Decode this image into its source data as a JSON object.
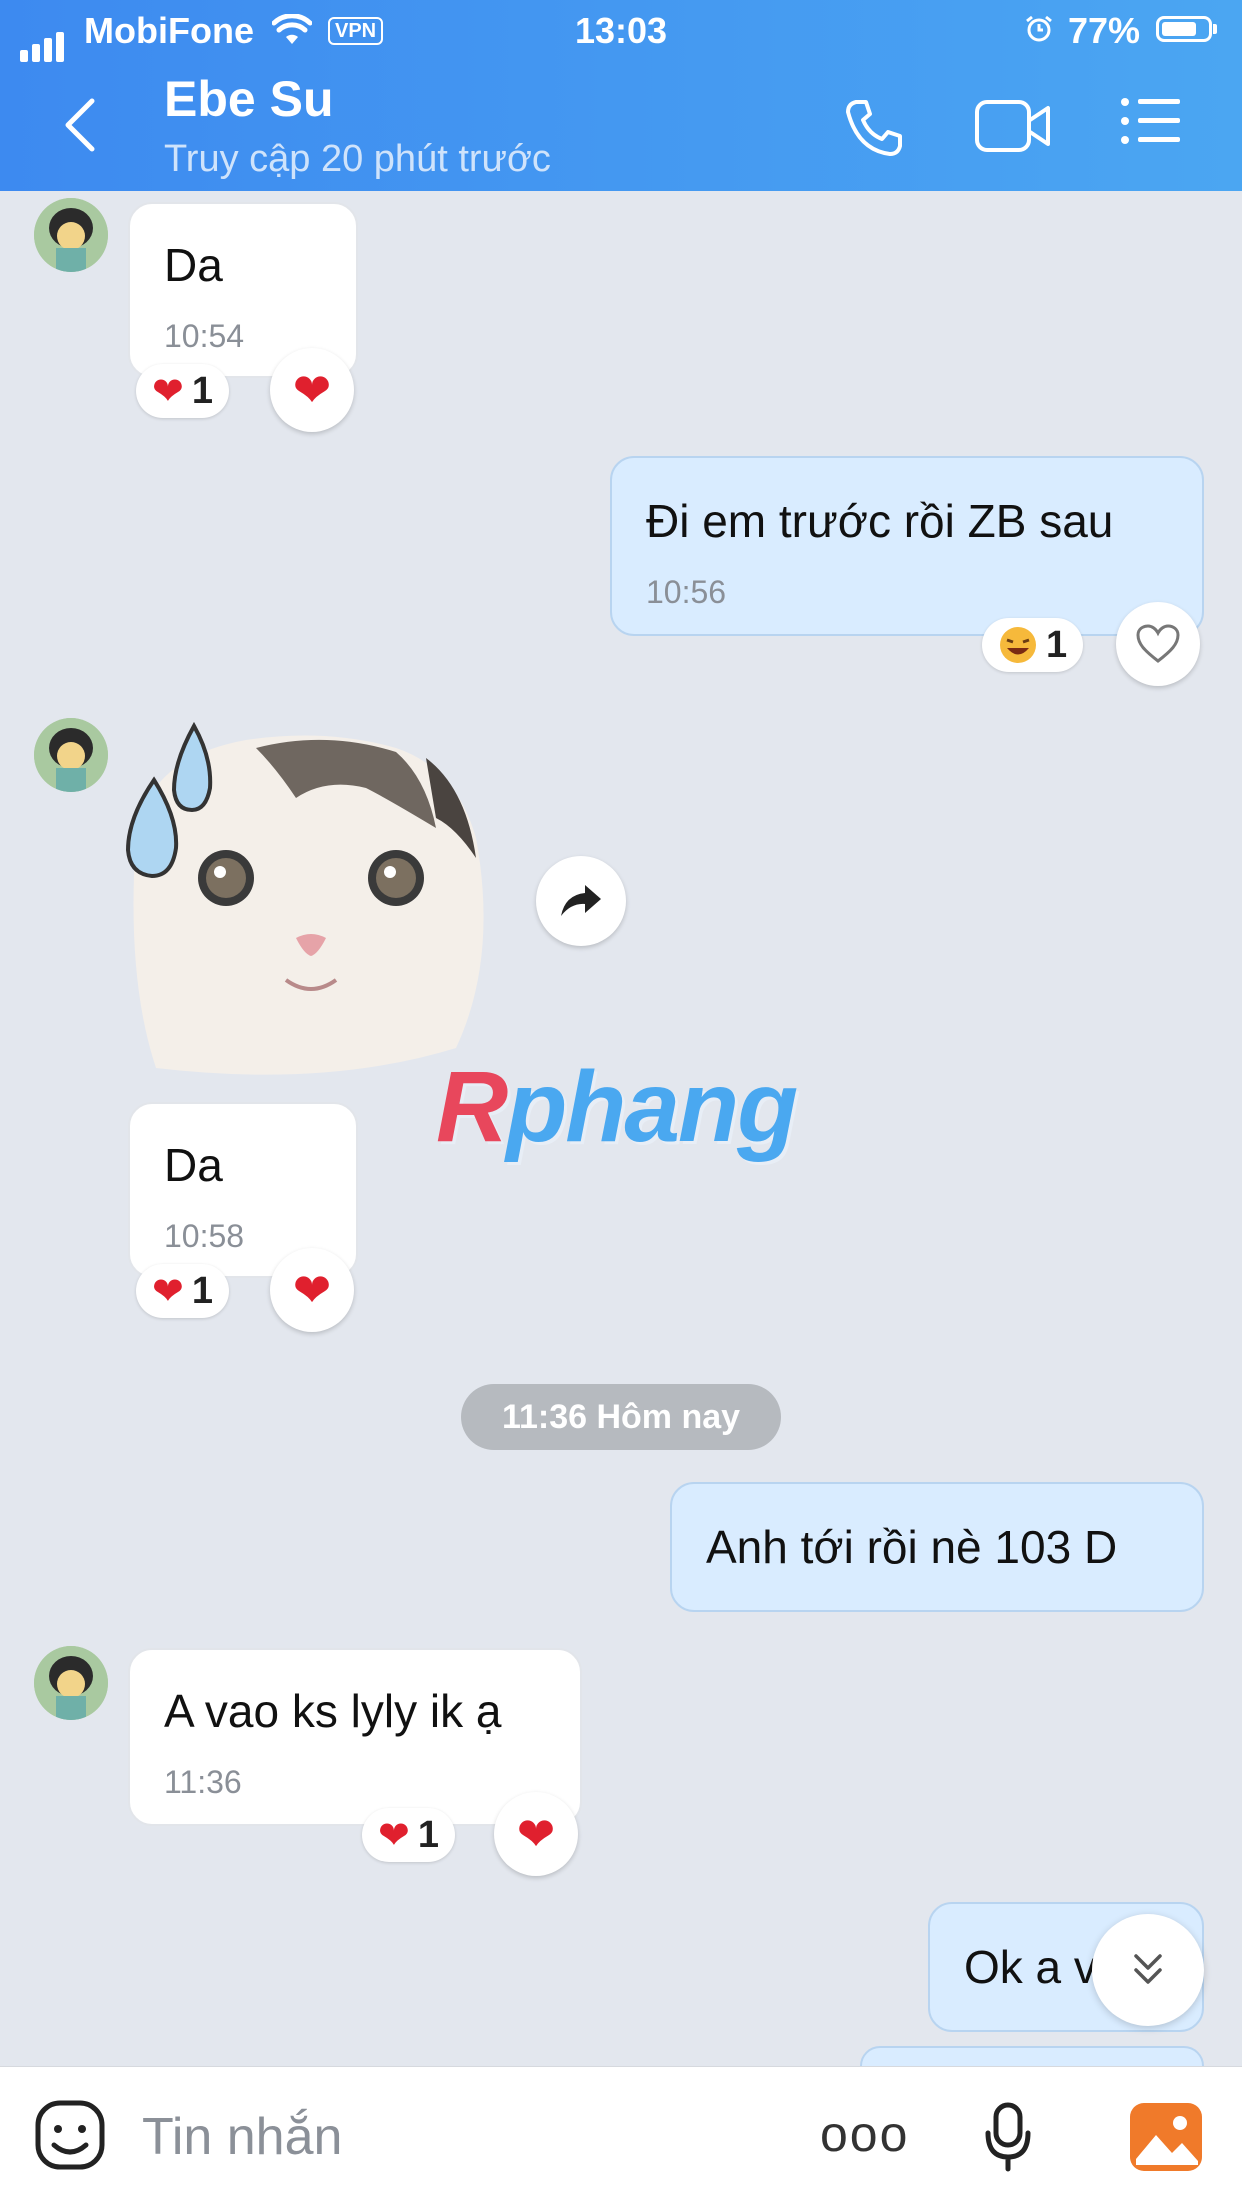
{
  "status_bar": {
    "carrier": "MobiFone",
    "vpn": "VPN",
    "time": "13:03",
    "battery": "77%"
  },
  "header": {
    "name": "Ebe Su",
    "subtitle": "Truy cập 20 phút trước"
  },
  "messages": [
    {
      "text": "Da",
      "time": "10:54",
      "reaction_count": "1"
    },
    {
      "text": "Đi em trước rồi ZB sau",
      "time": "10:56",
      "reaction_count": "1"
    },
    {
      "text": "Da",
      "time": "10:58",
      "reaction_count": "1"
    },
    {
      "text": "Anh tới rồi nè 103 D"
    },
    {
      "text": "A vao ks lyly ik ạ",
      "time": "11:36",
      "reaction_count": "1"
    },
    {
      "text": "Ok a v"
    }
  ],
  "date_divider": "11:36 Hôm nay",
  "watermark": {
    "r": "R",
    "rest": "phang"
  },
  "input": {
    "placeholder": "Tin nhắn",
    "more": "ooo"
  },
  "colors": {
    "header_start": "#3d8af0",
    "header_end": "#4ba6f2",
    "outgoing_bubble": "#d9ecff",
    "background": "#e3e7ee",
    "heart": "#e0202e"
  }
}
